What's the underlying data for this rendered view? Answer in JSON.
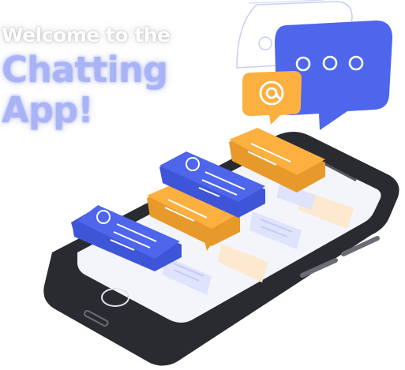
{
  "headline": {
    "line1": "Welcome to the",
    "line2": "Chatting",
    "line3": "App!"
  },
  "colors": {
    "accent_blue": "#4e66ec",
    "accent_orange": "#fbb040",
    "phone_dark": "#2a2b30",
    "screen": "#f4f5fb"
  },
  "icons": [
    "chat-bubble-icon",
    "typing-dots-icon",
    "at-sign-icon",
    "avatar-icon"
  ]
}
